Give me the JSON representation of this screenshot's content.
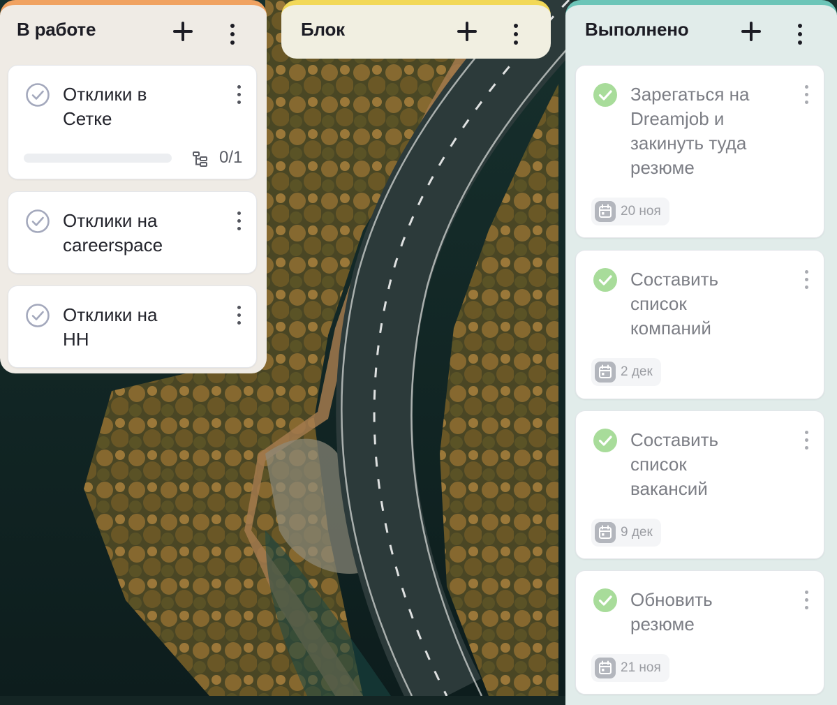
{
  "colors": {
    "col1_accent": "#f0a261",
    "col1_bg": "#efebe5",
    "col2_accent": "#f2d857",
    "col2_bg": "#f1efe1",
    "col3_accent": "#6cc5b8",
    "col3_bg": "#e1ecea",
    "check_done": "#a8dc9a",
    "check_outline": "#a3a8bc"
  },
  "columns": [
    {
      "title": "В работе",
      "add_icon": "plus-icon",
      "menu_icon": "kebab-icon",
      "cards": [
        {
          "title_lines": [
            "Отклики в",
            "Сетке"
          ],
          "status": "open",
          "progress": 0,
          "subtasks": "0/1"
        },
        {
          "title_lines": [
            "Отклики на",
            "careerspace"
          ],
          "status": "open"
        },
        {
          "title_lines": [
            "Отклики на",
            "НН"
          ],
          "status": "open"
        }
      ]
    },
    {
      "title": "Блок",
      "add_icon": "plus-icon",
      "menu_icon": "kebab-icon",
      "cards": []
    },
    {
      "title": "Выполнено",
      "add_icon": "plus-icon",
      "menu_icon": "kebab-icon",
      "cards": [
        {
          "title_lines": [
            "Зарегаться на",
            "Dreamjob и",
            "закинуть туда",
            "резюме"
          ],
          "status": "done",
          "date": "20 ноя",
          "date_icon": "calendar-icon"
        },
        {
          "title_lines": [
            "Составить",
            "список",
            "компаний"
          ],
          "status": "done",
          "date": "2 дек",
          "date_icon": "calendar-icon"
        },
        {
          "title_lines": [
            "Составить",
            "список",
            "вакансий"
          ],
          "status": "done",
          "date": "9 дек",
          "date_icon": "calendar-icon"
        },
        {
          "title_lines": [
            "Обновить",
            "резюме"
          ],
          "status": "done",
          "date": "21 ноя",
          "date_icon": "calendar-icon"
        }
      ]
    }
  ]
}
